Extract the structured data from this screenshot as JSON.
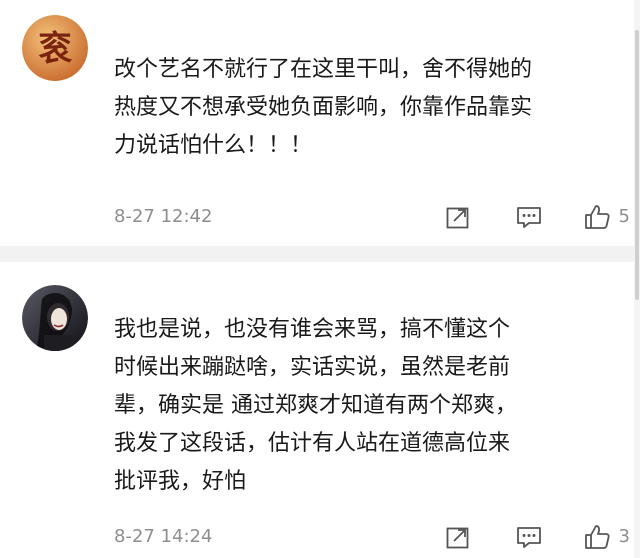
{
  "comments": [
    {
      "username": "",
      "avatar_glyph": "衮",
      "avatar_color": "#c96a2e",
      "text_lines": [
        "改个艺名不就行了在这里干叫，舍不得她的",
        "热度又不想承受她负面影响，你靠作品靠实",
        "力说话怕什么！！！"
      ],
      "timestamp": "8-27 12:42",
      "icons": {
        "share": "share-icon",
        "comment": "comment-icon",
        "like": "thumbs-up-icon"
      },
      "likes": "5"
    },
    {
      "username": "",
      "avatar_color": "#2b2b30",
      "text_lines": [
        "我也是说，也没有谁会来骂，搞不懂这个",
        "时候出来蹦跶啥，实话实说，虽然是老前",
        "辈，确实是 通过郑爽才知道有两个郑爽，",
        "我发了这段话，估计有人站在道德高位来",
        "批评我，好怕"
      ],
      "timestamp": "8-27 14:24",
      "icons": {
        "share": "share-icon",
        "comment": "comment-icon",
        "like": "thumbs-up-icon"
      },
      "likes": "3"
    }
  ]
}
